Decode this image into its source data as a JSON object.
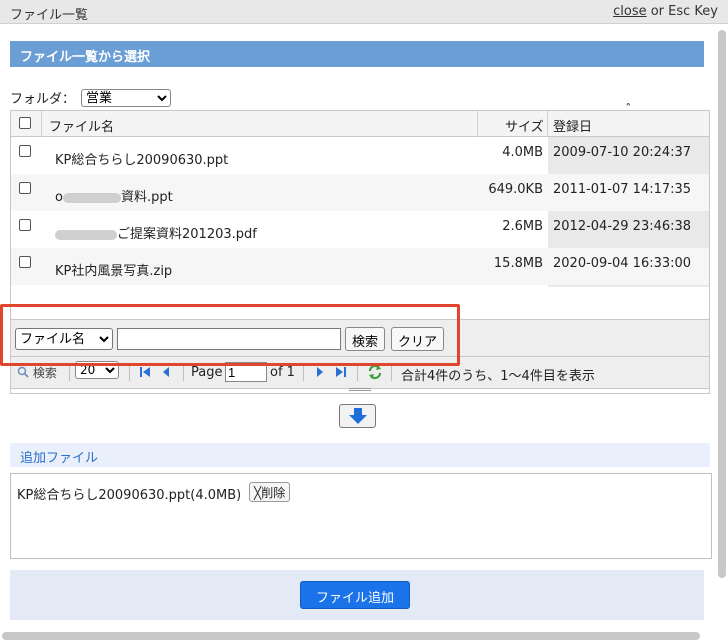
{
  "window": {
    "title": "ファイル一覧",
    "close_link": "close",
    "close_hint": " or Esc Key"
  },
  "section_title": "ファイル一覧から選択",
  "folder": {
    "label": "フォルダ：",
    "selected": "営業"
  },
  "grid": {
    "columns": {
      "name": "ファイル名",
      "size": "サイズ",
      "date": "登録日"
    },
    "sort_indicator": "ˆ",
    "rows": [
      {
        "name": "KP総合ちらし20090630.ppt",
        "size": "4.0MB",
        "date": "2009-07-10 20:24:37"
      },
      {
        "name_prefix": "o",
        "name": "資料.ppt",
        "size": "649.0KB",
        "date": "2011-01-07 14:17:35"
      },
      {
        "name": "ご提案資料201203.pdf",
        "size": "2.6MB",
        "date": "2012-04-29 23:46:38"
      },
      {
        "name": "KP社内風景写真.zip",
        "size": "15.8MB",
        "date": "2020-09-04 16:33:00"
      }
    ]
  },
  "search": {
    "field_selected": "ファイル名",
    "query_value": "",
    "search_button": "検索",
    "clear_button": "クリア"
  },
  "pager": {
    "search_label": "検索",
    "page_size": "20",
    "page_label": "Page",
    "page_value": "1",
    "of_label": "of 1",
    "summary": "合計4件のうち、1〜4件目を表示"
  },
  "added": {
    "header": "追加ファイル",
    "items": [
      {
        "label": "KP総合ちらし20090630.ppt(4.0MB)",
        "delete_label": "削除",
        "delete_mark": "╳"
      }
    ]
  },
  "footer": {
    "add_button": "ファイル追加"
  },
  "colors": {
    "section_header": "#6a9ed4",
    "primary_button": "#1a73e8",
    "highlight": "#e0462e",
    "added_header_text": "#2c6fc6"
  }
}
